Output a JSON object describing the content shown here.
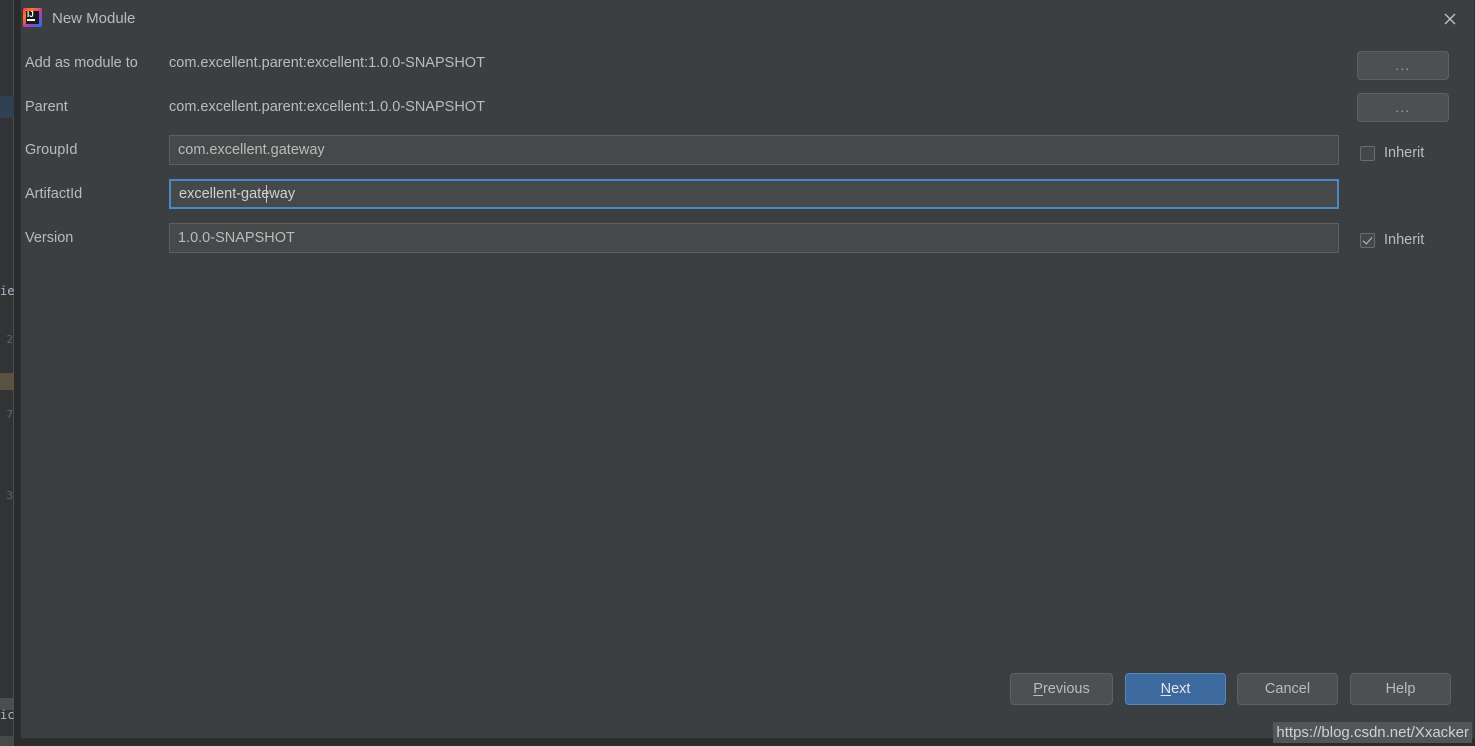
{
  "window": {
    "title": "New Module",
    "app_icon": "intellij-idea-icon",
    "close_icon": "close-icon"
  },
  "form": {
    "rows": [
      {
        "label": "Add as module to",
        "type": "static",
        "value": "com.excellent.parent:excellent:1.0.0-SNAPSHOT",
        "browse_label": "...",
        "has_browse": true
      },
      {
        "label": "Parent",
        "type": "static",
        "value": "com.excellent.parent:excellent:1.0.0-SNAPSHOT",
        "browse_label": "...",
        "has_browse": true
      },
      {
        "label": "GroupId",
        "type": "input",
        "value": "com.excellent.gateway",
        "focused": false,
        "inherit_label": "Inherit",
        "inherit_checked": false,
        "has_inherit": true
      },
      {
        "label": "ArtifactId",
        "type": "input",
        "value": "excellent-gateway",
        "focused": true,
        "has_inherit": false
      },
      {
        "label": "Version",
        "type": "input",
        "value": "1.0.0-SNAPSHOT",
        "focused": false,
        "inherit_label": "Inherit",
        "inherit_checked": true,
        "has_inherit": true
      }
    ]
  },
  "footer": {
    "previous_label": "Previous",
    "previous_mnemonic": "P",
    "next_label": "Next",
    "next_mnemonic": "N",
    "cancel_label": "Cancel",
    "help_label": "Help"
  },
  "watermark": {
    "text": "https://blog.csdn.net/Xxacker"
  },
  "backdrop": {
    "line_numbers": [
      "2",
      "7",
      "3"
    ],
    "tokens": [
      "ie",
      "ic"
    ]
  },
  "colors": {
    "dialog_bg": "#3c3f41",
    "field_bg": "#45494a",
    "focus_border": "#4b88c6",
    "primary_button": "#3c6a9e",
    "text": "#bbbbbb"
  }
}
